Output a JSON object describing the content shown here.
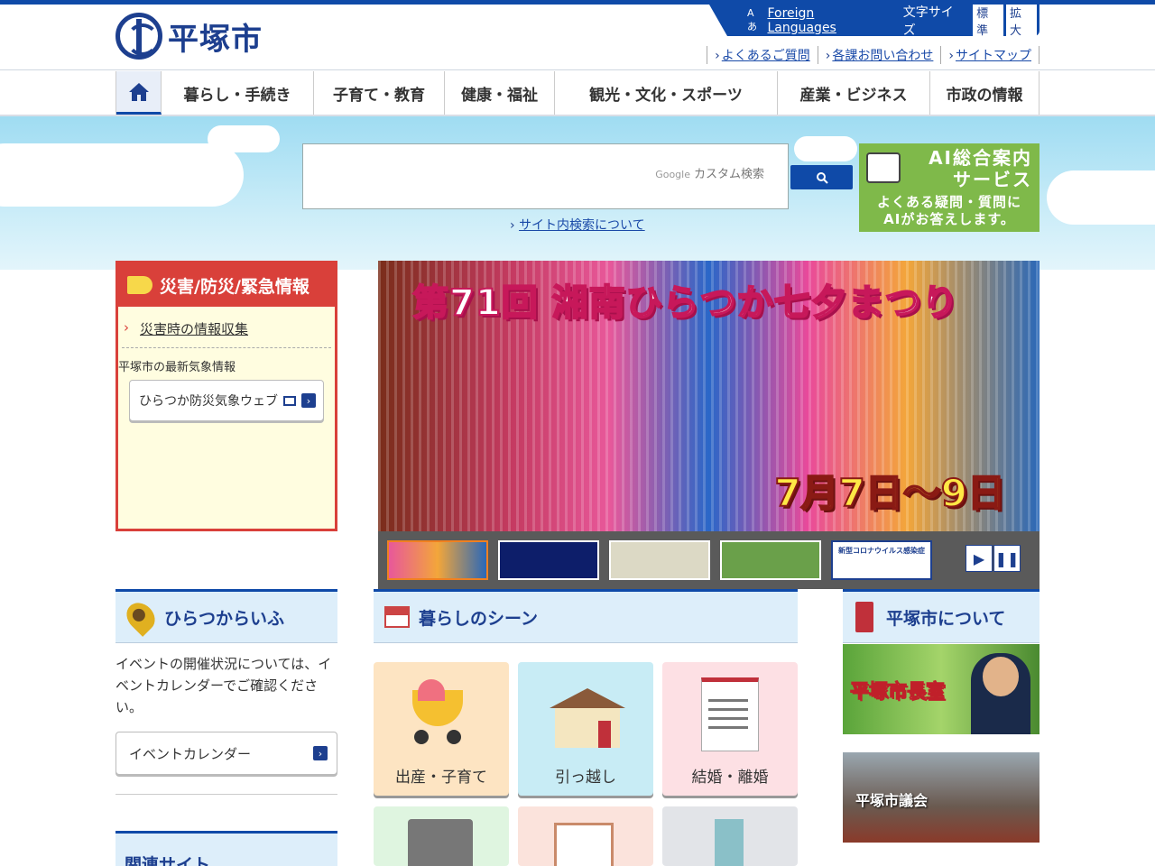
{
  "header": {
    "logo_text": "平塚市",
    "foreign_languages": "Foreign Languages",
    "font_size_label": "文字サイズ",
    "font_standard": "標準",
    "font_large": "拡大",
    "sublinks": [
      "よくあるご質問",
      "各課お問い合わせ",
      "サイトマップ"
    ]
  },
  "global_nav": [
    "暮らし・手続き",
    "子育て・教育",
    "健康・福祉",
    "観光・文化・スポーツ",
    "産業・ビジネス",
    "市政の情報"
  ],
  "search": {
    "placeholder_brand": "Google",
    "placeholder": "カスタム検索",
    "button_icon": "search-icon",
    "about_link": "サイト内検索について"
  },
  "ai_banner": {
    "title_line1": "AI総合案内",
    "title_line2": "サービス",
    "subtitle_line1": "よくある疑問・質問に",
    "subtitle_line2": "AIがお答えします。"
  },
  "disaster": {
    "heading": "災害/防災/緊急情報",
    "link": "災害時の情報収集",
    "note": "平塚市の最新気象情報",
    "button": "ひらつか防災気象ウェブ"
  },
  "hero": {
    "title": "第71回 湘南ひらつか七夕まつり",
    "dates": "7月7日〜9日"
  },
  "thumbnails": [
    "新型コロナウイルス感染症"
  ],
  "life": {
    "heading": "ひらつからいふ",
    "text": "イベントの開催状況については、イベントカレンダーでご確認ください。",
    "button": "イベントカレンダー"
  },
  "related": {
    "heading": "関連サイト"
  },
  "scenes": {
    "heading": "暮らしのシーン",
    "items": [
      "出産・子育て",
      "引っ越し",
      "結婚・離婚"
    ]
  },
  "about": {
    "heading": "平塚市について",
    "mayor": "平塚市長室",
    "council": "平塚市議会"
  }
}
